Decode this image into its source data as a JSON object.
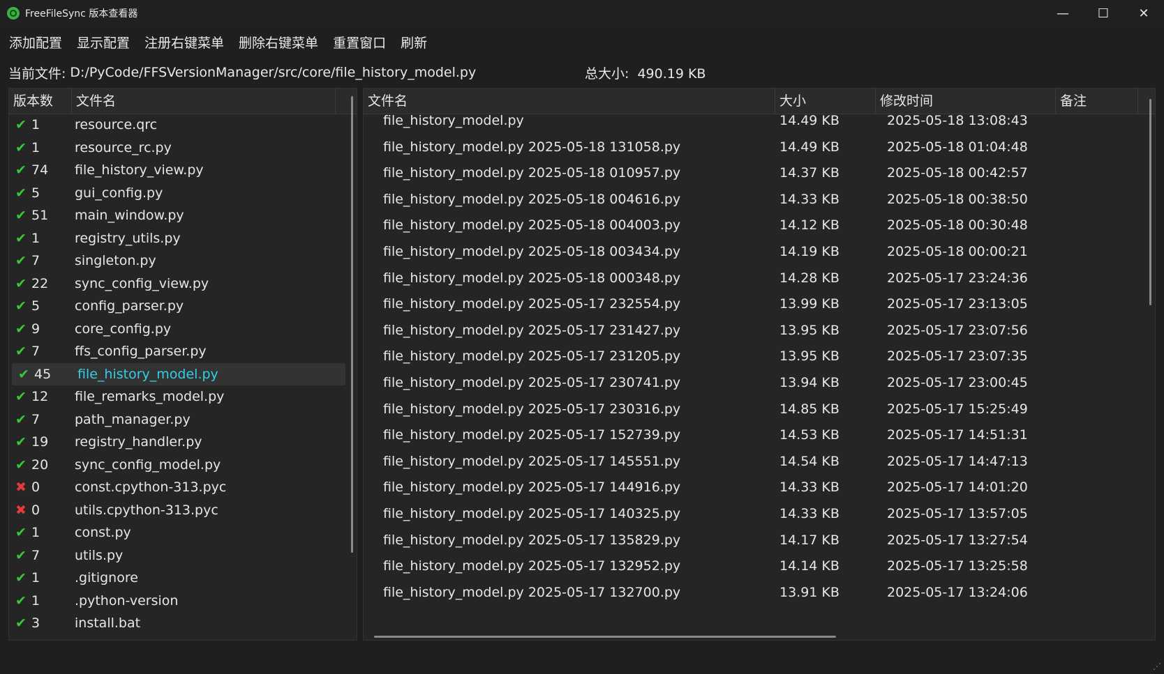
{
  "window": {
    "title": "FreeFileSync 版本查看器"
  },
  "menu": [
    "添加配置",
    "显示配置",
    "注册右键菜单",
    "删除右键菜单",
    "重置窗口",
    "刷新"
  ],
  "info": {
    "current_label": "当前文件:",
    "current_path": "D:/PyCode/FFSVersionManager/src/core/file_history_model.py",
    "size_label": "总大小:",
    "size_value": "490.19 KB"
  },
  "left_table": {
    "headers": [
      "版本数",
      "文件名"
    ],
    "rows": [
      {
        "ok": true,
        "count": "1",
        "name": "resource.qrc"
      },
      {
        "ok": true,
        "count": "1",
        "name": "resource_rc.py"
      },
      {
        "ok": true,
        "count": "74",
        "name": "file_history_view.py"
      },
      {
        "ok": true,
        "count": "5",
        "name": "gui_config.py"
      },
      {
        "ok": true,
        "count": "51",
        "name": "main_window.py"
      },
      {
        "ok": true,
        "count": "1",
        "name": "registry_utils.py"
      },
      {
        "ok": true,
        "count": "7",
        "name": "singleton.py"
      },
      {
        "ok": true,
        "count": "22",
        "name": "sync_config_view.py"
      },
      {
        "ok": true,
        "count": "5",
        "name": "config_parser.py"
      },
      {
        "ok": true,
        "count": "9",
        "name": "core_config.py"
      },
      {
        "ok": true,
        "count": "7",
        "name": "ffs_config_parser.py"
      },
      {
        "ok": true,
        "count": "45",
        "name": "file_history_model.py",
        "selected": true
      },
      {
        "ok": true,
        "count": "12",
        "name": "file_remarks_model.py"
      },
      {
        "ok": true,
        "count": "7",
        "name": "path_manager.py"
      },
      {
        "ok": true,
        "count": "19",
        "name": "registry_handler.py"
      },
      {
        "ok": true,
        "count": "20",
        "name": "sync_config_model.py"
      },
      {
        "ok": false,
        "count": "0",
        "name": "const.cpython-313.pyc"
      },
      {
        "ok": false,
        "count": "0",
        "name": "utils.cpython-313.pyc"
      },
      {
        "ok": true,
        "count": "1",
        "name": "const.py"
      },
      {
        "ok": true,
        "count": "7",
        "name": "utils.py"
      },
      {
        "ok": true,
        "count": "1",
        "name": ".gitignore"
      },
      {
        "ok": true,
        "count": "1",
        "name": ".python-version"
      },
      {
        "ok": true,
        "count": "3",
        "name": "install.bat"
      }
    ]
  },
  "right_table": {
    "headers": [
      "文件名",
      "大小",
      "修改时间",
      "备注"
    ],
    "rows": [
      {
        "name": "file_history_model.py",
        "size": "14.49 KB",
        "time": "2025-05-18 13:08:43"
      },
      {
        "name": "file_history_model.py 2025-05-18 131058.py",
        "size": "14.49 KB",
        "time": "2025-05-18 01:04:48"
      },
      {
        "name": "file_history_model.py 2025-05-18 010957.py",
        "size": "14.37 KB",
        "time": "2025-05-18 00:42:57"
      },
      {
        "name": "file_history_model.py 2025-05-18 004616.py",
        "size": "14.33 KB",
        "time": "2025-05-18 00:38:50"
      },
      {
        "name": "file_history_model.py 2025-05-18 004003.py",
        "size": "14.12 KB",
        "time": "2025-05-18 00:30:48"
      },
      {
        "name": "file_history_model.py 2025-05-18 003434.py",
        "size": "14.19 KB",
        "time": "2025-05-18 00:00:21"
      },
      {
        "name": "file_history_model.py 2025-05-18 000348.py",
        "size": "14.28 KB",
        "time": "2025-05-17 23:24:36"
      },
      {
        "name": "file_history_model.py 2025-05-17 232554.py",
        "size": "13.99 KB",
        "time": "2025-05-17 23:13:05"
      },
      {
        "name": "file_history_model.py 2025-05-17 231427.py",
        "size": "13.95 KB",
        "time": "2025-05-17 23:07:56"
      },
      {
        "name": "file_history_model.py 2025-05-17 231205.py",
        "size": "13.95 KB",
        "time": "2025-05-17 23:07:35"
      },
      {
        "name": "file_history_model.py 2025-05-17 230741.py",
        "size": "13.94 KB",
        "time": "2025-05-17 23:00:45"
      },
      {
        "name": "file_history_model.py 2025-05-17 230316.py",
        "size": "14.85 KB",
        "time": "2025-05-17 15:25:49"
      },
      {
        "name": "file_history_model.py 2025-05-17 152739.py",
        "size": "14.53 KB",
        "time": "2025-05-17 14:51:31"
      },
      {
        "name": "file_history_model.py 2025-05-17 145551.py",
        "size": "14.54 KB",
        "time": "2025-05-17 14:47:13"
      },
      {
        "name": "file_history_model.py 2025-05-17 144916.py",
        "size": "14.33 KB",
        "time": "2025-05-17 14:01:20"
      },
      {
        "name": "file_history_model.py 2025-05-17 140325.py",
        "size": "14.33 KB",
        "time": "2025-05-17 13:57:05"
      },
      {
        "name": "file_history_model.py 2025-05-17 135829.py",
        "size": "14.17 KB",
        "time": "2025-05-17 13:27:54"
      },
      {
        "name": "file_history_model.py 2025-05-17 132952.py",
        "size": "14.14 KB",
        "time": "2025-05-17 13:25:58"
      },
      {
        "name": "file_history_model.py 2025-05-17 132700.py",
        "size": "13.91 KB",
        "time": "2025-05-17 13:24:06"
      }
    ]
  },
  "icons": {
    "app": "freefilesync-app-icon",
    "minimize": "minimize-icon",
    "maximize": "maximize-icon",
    "close": "close-icon",
    "ok": "check-icon",
    "bad": "cross-icon"
  },
  "colors": {
    "ok": "#37c837",
    "bad": "#e33b3b",
    "selected_text": "#2fd0e6",
    "background": "#1f1f1f"
  }
}
